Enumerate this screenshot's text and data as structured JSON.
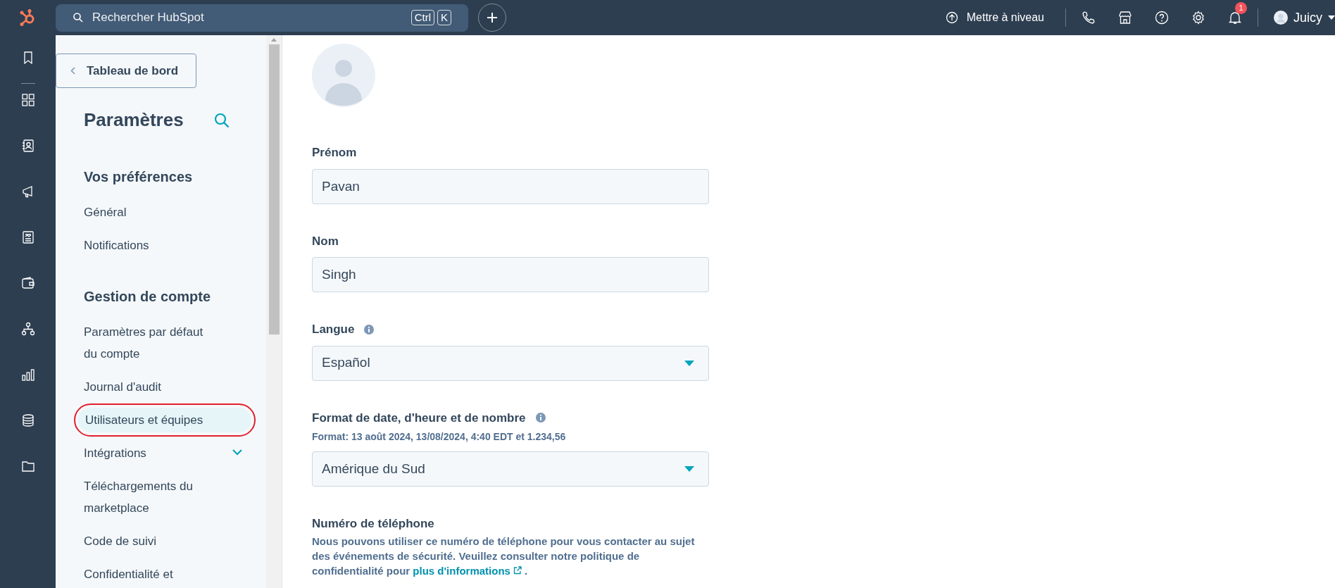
{
  "top_bar": {
    "search": {
      "placeholder": "Rechercher HubSpot",
      "shortcut": [
        "Ctrl",
        "K"
      ]
    },
    "upgrade": "Mettre à niveau",
    "notifications_count": "1",
    "user": "Juicy"
  },
  "sidebar": {
    "back": "Tableau de bord",
    "title": "Paramètres",
    "sections": [
      {
        "heading": "Vos préférences",
        "items": [
          {
            "label": "Général",
            "selected": false
          },
          {
            "label": "Notifications",
            "selected": false
          }
        ]
      },
      {
        "heading": "Gestion de compte",
        "items": [
          {
            "label": "Paramètres par défaut du compte",
            "selected": false
          },
          {
            "label": "Journal d'audit",
            "selected": false
          },
          {
            "label": "Utilisateurs et équipes",
            "selected": true,
            "annotated": true
          },
          {
            "label": "Intégrations",
            "selected": false,
            "expandable": true,
            "expanded": false
          },
          {
            "label": "Téléchargements du marketplace",
            "selected": false
          },
          {
            "label": "Code de suivi",
            "selected": false
          },
          {
            "label": "Confidentialité et",
            "selected": false
          }
        ]
      }
    ]
  },
  "form": {
    "fields": [
      {
        "kind": "text",
        "label": "Prénom",
        "value": "Pavan"
      },
      {
        "kind": "text",
        "label": "Nom",
        "value": "Singh"
      },
      {
        "kind": "select",
        "label": "Langue",
        "info": true,
        "value": "Español"
      },
      {
        "kind": "select",
        "label": "Format de date, d'heure et de nombre",
        "info": true,
        "hint": "Format: 13 août 2024, 13/08/2024, 4:40 EDT et 1.234,56",
        "value": "Amérique du Sud"
      }
    ],
    "phone": {
      "label": "Numéro de téléphone",
      "text": "Nous pouvons utiliser ce numéro de téléphone pour vous contacter au sujet des événements de sécurité. Veuillez consulter notre politique de confidentialité pour",
      "link": "plus d'informations",
      "end": "."
    }
  }
}
